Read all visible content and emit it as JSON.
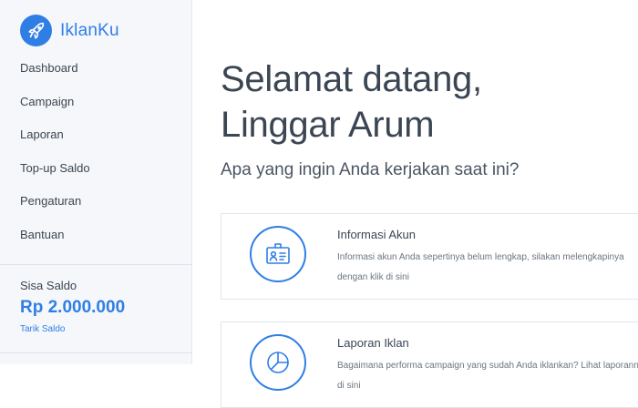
{
  "app": {
    "brand_name": "IklanKu",
    "accent_color": "#2f7ee6",
    "logo_icon": "rocket-icon"
  },
  "sidebar": {
    "items": [
      {
        "label": "Dashboard"
      },
      {
        "label": "Campaign"
      },
      {
        "label": "Laporan"
      },
      {
        "label": "Top-up Saldo"
      },
      {
        "label": "Pengaturan"
      },
      {
        "label": "Bantuan"
      }
    ],
    "balance": {
      "label": "Sisa Saldo",
      "value": "Rp 2.000.000",
      "link": "Tarik Saldo"
    }
  },
  "main": {
    "greeting_line1": "Selamat datang,",
    "greeting_line2": "Linggar Arum",
    "subtitle": "Apa yang ingin Anda kerjakan saat ini?",
    "cards": [
      {
        "title": "Informasi Akun",
        "description": "Informasi akun Anda sepertinya belum lengkap, silakan melengkapinya dengan klik di sini",
        "icon": "id-card-icon"
      },
      {
        "title": "Laporan Iklan",
        "description": "Bagaimana performa campaign yang sudah Anda iklankan? Lihat laporannya di sini",
        "icon": "pie-chart-icon"
      }
    ]
  }
}
